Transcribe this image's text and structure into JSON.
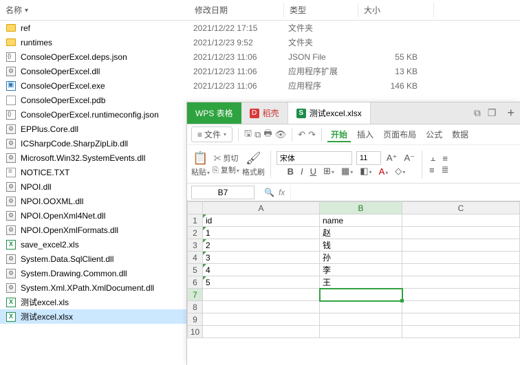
{
  "explorer": {
    "headers": {
      "name": "名称",
      "date": "修改日期",
      "type": "类型",
      "size": "大小"
    },
    "files": [
      {
        "icon": "folder",
        "name": "ref",
        "date": "2021/12/22 17:15",
        "type": "文件夹",
        "size": ""
      },
      {
        "icon": "folder",
        "name": "runtimes",
        "date": "2021/12/23 9:52",
        "type": "文件夹",
        "size": ""
      },
      {
        "icon": "json",
        "name": "ConsoleOperExcel.deps.json",
        "date": "2021/12/23 11:06",
        "type": "JSON File",
        "size": "55 KB"
      },
      {
        "icon": "dll",
        "name": "ConsoleOperExcel.dll",
        "date": "2021/12/23 11:06",
        "type": "应用程序扩展",
        "size": "13 KB"
      },
      {
        "icon": "exe",
        "name": "ConsoleOperExcel.exe",
        "date": "2021/12/23 11:06",
        "type": "应用程序",
        "size": "146 KB"
      },
      {
        "icon": "pdb",
        "name": "ConsoleOperExcel.pdb",
        "date": "",
        "type": "",
        "size": ""
      },
      {
        "icon": "json",
        "name": "ConsoleOperExcel.runtimeconfig.json",
        "date": "",
        "type": "",
        "size": ""
      },
      {
        "icon": "dll",
        "name": "EPPlus.Core.dll",
        "date": "",
        "type": "",
        "size": ""
      },
      {
        "icon": "dll",
        "name": "ICSharpCode.SharpZipLib.dll",
        "date": "",
        "type": "",
        "size": ""
      },
      {
        "icon": "dll",
        "name": "Microsoft.Win32.SystemEvents.dll",
        "date": "",
        "type": "",
        "size": ""
      },
      {
        "icon": "txt",
        "name": "NOTICE.TXT",
        "date": "",
        "type": "",
        "size": ""
      },
      {
        "icon": "dll",
        "name": "NPOI.dll",
        "date": "",
        "type": "",
        "size": ""
      },
      {
        "icon": "dll",
        "name": "NPOI.OOXML.dll",
        "date": "",
        "type": "",
        "size": ""
      },
      {
        "icon": "dll",
        "name": "NPOI.OpenXml4Net.dll",
        "date": "",
        "type": "",
        "size": ""
      },
      {
        "icon": "dll",
        "name": "NPOI.OpenXmlFormats.dll",
        "date": "",
        "type": "",
        "size": ""
      },
      {
        "icon": "xls",
        "name": "save_excel2.xls",
        "date": "",
        "type": "",
        "size": ""
      },
      {
        "icon": "dll",
        "name": "System.Data.SqlClient.dll",
        "date": "",
        "type": "",
        "size": ""
      },
      {
        "icon": "dll",
        "name": "System.Drawing.Common.dll",
        "date": "",
        "type": "",
        "size": ""
      },
      {
        "icon": "dll",
        "name": "System.Xml.XPath.XmlDocument.dll",
        "date": "",
        "type": "",
        "size": ""
      },
      {
        "icon": "xls",
        "name": "测试excel.xls",
        "date": "",
        "type": "",
        "size": ""
      },
      {
        "icon": "xls",
        "name": "测试excel.xlsx",
        "date": "",
        "type": "",
        "size": "",
        "selected": true
      }
    ]
  },
  "wps": {
    "tabs": {
      "app": "WPS 表格",
      "daoke": "稻壳",
      "file": "测试excel.xlsx"
    },
    "menu": {
      "file": "文件",
      "start": "开始",
      "insert": "插入",
      "layout": "页面布局",
      "formula": "公式",
      "data": "数据"
    },
    "toolbar": {
      "paste": "粘贴",
      "cut": "剪切",
      "copy": "复制",
      "format": "格式刷",
      "font": "宋体",
      "fontsize": "11",
      "b": "B",
      "i": "I",
      "u": "U"
    },
    "cellref": "B7",
    "cols": [
      "A",
      "B",
      "C"
    ],
    "rows": [
      {
        "n": "1",
        "a": "id",
        "b": "name"
      },
      {
        "n": "2",
        "a": "1",
        "b": "赵"
      },
      {
        "n": "3",
        "a": "2",
        "b": "钱"
      },
      {
        "n": "4",
        "a": "3",
        "b": "孙"
      },
      {
        "n": "5",
        "a": "4",
        "b": "李"
      },
      {
        "n": "6",
        "a": "5",
        "b": "王"
      },
      {
        "n": "7",
        "a": "",
        "b": "",
        "cursor": "b"
      },
      {
        "n": "8",
        "a": "",
        "b": ""
      },
      {
        "n": "9",
        "a": "",
        "b": ""
      },
      {
        "n": "10",
        "a": "",
        "b": ""
      }
    ]
  }
}
